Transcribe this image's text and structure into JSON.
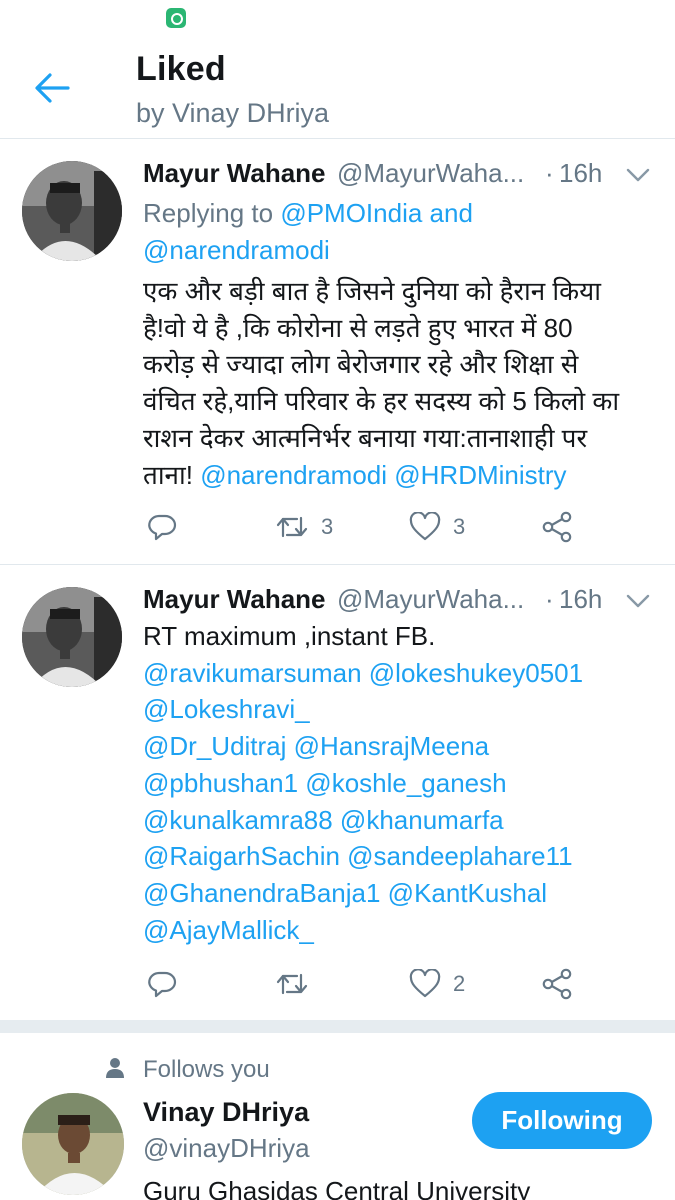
{
  "header": {
    "title": "Liked",
    "subtitle": "by Vinay DHriya"
  },
  "tweets": [
    {
      "name": "Mayur Wahane",
      "handle": "@MayurWaha...",
      "dot": "·",
      "time": "16h",
      "reply_prefix": "Replying to",
      "reply_to_1": "@PMOIndia",
      "reply_and": "and",
      "reply_to_2": "@narendramodi",
      "text_lines": [
        "एक और बड़ी बात है जिसने दुनिया को हैरान किया",
        "है!वो ये है ,कि कोरोना से लड़ते हुए भारत में 80",
        "करोड़ से ज्यादा लोग बेरोजगार रहे और शिक्षा से",
        "वंचित रहे,यानि परिवार के हर सदस्य को 5 किलो का",
        "राशन देकर आत्मनिर्भर बनाया गया:तानाशाही पर"
      ],
      "last_line_text": "ताना!",
      "last_line_mentions": [
        "@narendramodi",
        "@HRDMinistry"
      ],
      "retweets": "3",
      "likes": "3"
    },
    {
      "name": "Mayur Wahane",
      "handle": "@MayurWaha...",
      "dot": "·",
      "time": "16h",
      "first_line": "RT maximum ,instant FB.",
      "mention_lines": [
        "@ravikumarsuman @lokeshukey0501",
        "@Lokeshravi_",
        "@Dr_Uditraj @HansrajMeena",
        "@pbhushan1 @koshle_ganesh",
        "@kunalkamra88 @khanumarfa",
        "@RaigarhSachin @sandeeplahare11",
        "@GhanendraBanja1 @KantKushal",
        "@AjayMallick_"
      ],
      "likes": "2"
    }
  ],
  "follow_card": {
    "label": "Follows you",
    "name": "Vinay DHriya",
    "handle": "@vinayDHriya",
    "button": "Following",
    "bio": "Guru Ghasidas Central University"
  },
  "colors": {
    "accent": "#1da1f2",
    "muted": "#657786",
    "text": "#14171a",
    "divider": "#e1e8ed"
  },
  "icons": {
    "back": "arrow-left-icon",
    "caret": "chevron-down-icon",
    "reply": "reply-icon",
    "retweet": "retweet-icon",
    "like": "heart-icon",
    "share": "share-icon",
    "person": "person-icon"
  }
}
